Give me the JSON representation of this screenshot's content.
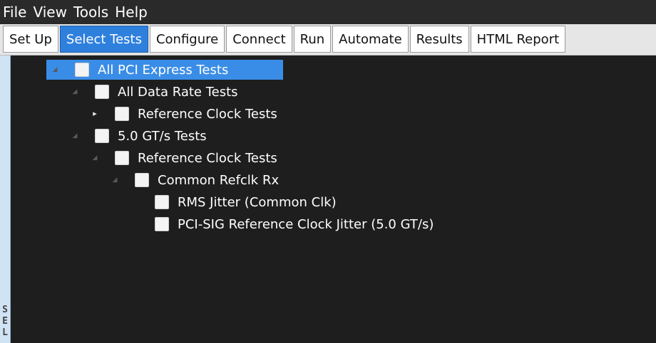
{
  "menubar": {
    "items": [
      "File",
      "View",
      "Tools",
      "Help"
    ]
  },
  "tabs": [
    {
      "label": "Set Up",
      "active": false
    },
    {
      "label": "Select Tests",
      "active": true
    },
    {
      "label": "Configure",
      "active": false
    },
    {
      "label": "Connect",
      "active": false
    },
    {
      "label": "Run",
      "active": false
    },
    {
      "label": "Automate",
      "active": false
    },
    {
      "label": "Results",
      "active": false
    },
    {
      "label": "HTML Report",
      "active": false
    }
  ],
  "sidestrip": {
    "label": "SEL"
  },
  "tree": [
    {
      "label": "All PCI Express Tests",
      "level": 0,
      "expanded": true,
      "selected": true
    },
    {
      "label": "All Data Rate Tests",
      "level": 1,
      "expanded": true,
      "selected": false
    },
    {
      "label": "Reference Clock Tests",
      "level": 2,
      "expanded": false,
      "selected": false
    },
    {
      "label": "5.0 GT/s Tests",
      "level": 1,
      "expanded": true,
      "selected": false
    },
    {
      "label": "Reference Clock Tests",
      "level": 2,
      "expanded": true,
      "selected": false
    },
    {
      "label": "Common Refclk Rx",
      "level": 3,
      "expanded": true,
      "selected": false
    },
    {
      "label": "RMS Jitter (Common Clk)",
      "level": 4,
      "expanded": null,
      "selected": false
    },
    {
      "label": "PCI-SIG Reference Clock Jitter (5.0 GT/s)",
      "level": 4,
      "expanded": null,
      "selected": false
    }
  ]
}
